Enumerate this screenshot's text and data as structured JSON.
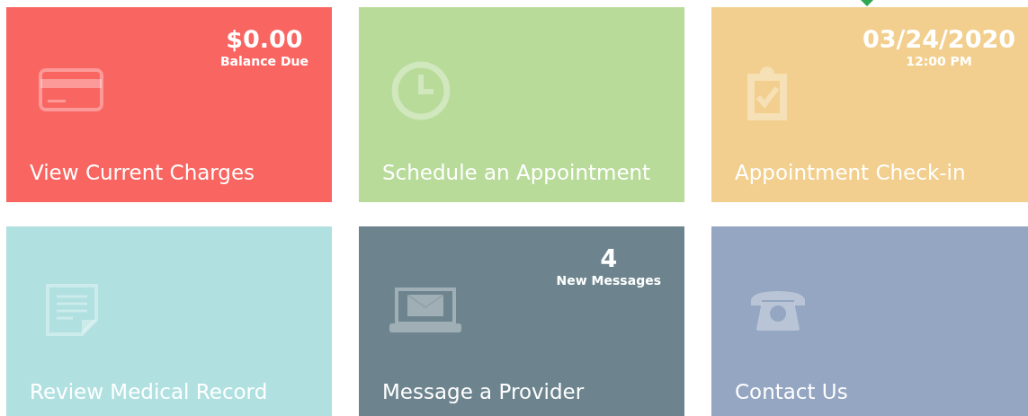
{
  "tiles": [
    {
      "kind": "card",
      "color": "#f96561",
      "title": "View Current Charges",
      "stat": {
        "value": "$0.00",
        "caption": "Balance Due"
      }
    },
    {
      "kind": "clock",
      "color": "#b8db9a",
      "title": "Schedule an Appointment"
    },
    {
      "kind": "clipboard",
      "color": "#f2cf8e",
      "title": "Appointment Check-in",
      "marker": true,
      "stat": {
        "value": "03/24/2020",
        "caption": "12:00 PM"
      }
    },
    {
      "kind": "document",
      "color": "#b1e0e1",
      "title": "Review Medical Record"
    },
    {
      "kind": "laptop",
      "color": "#6d848e",
      "title": "Message a Provider",
      "stat": {
        "value": "4",
        "caption": "New Messages"
      }
    },
    {
      "kind": "phone",
      "color": "#94a6c1",
      "title": "Contact Us"
    }
  ]
}
